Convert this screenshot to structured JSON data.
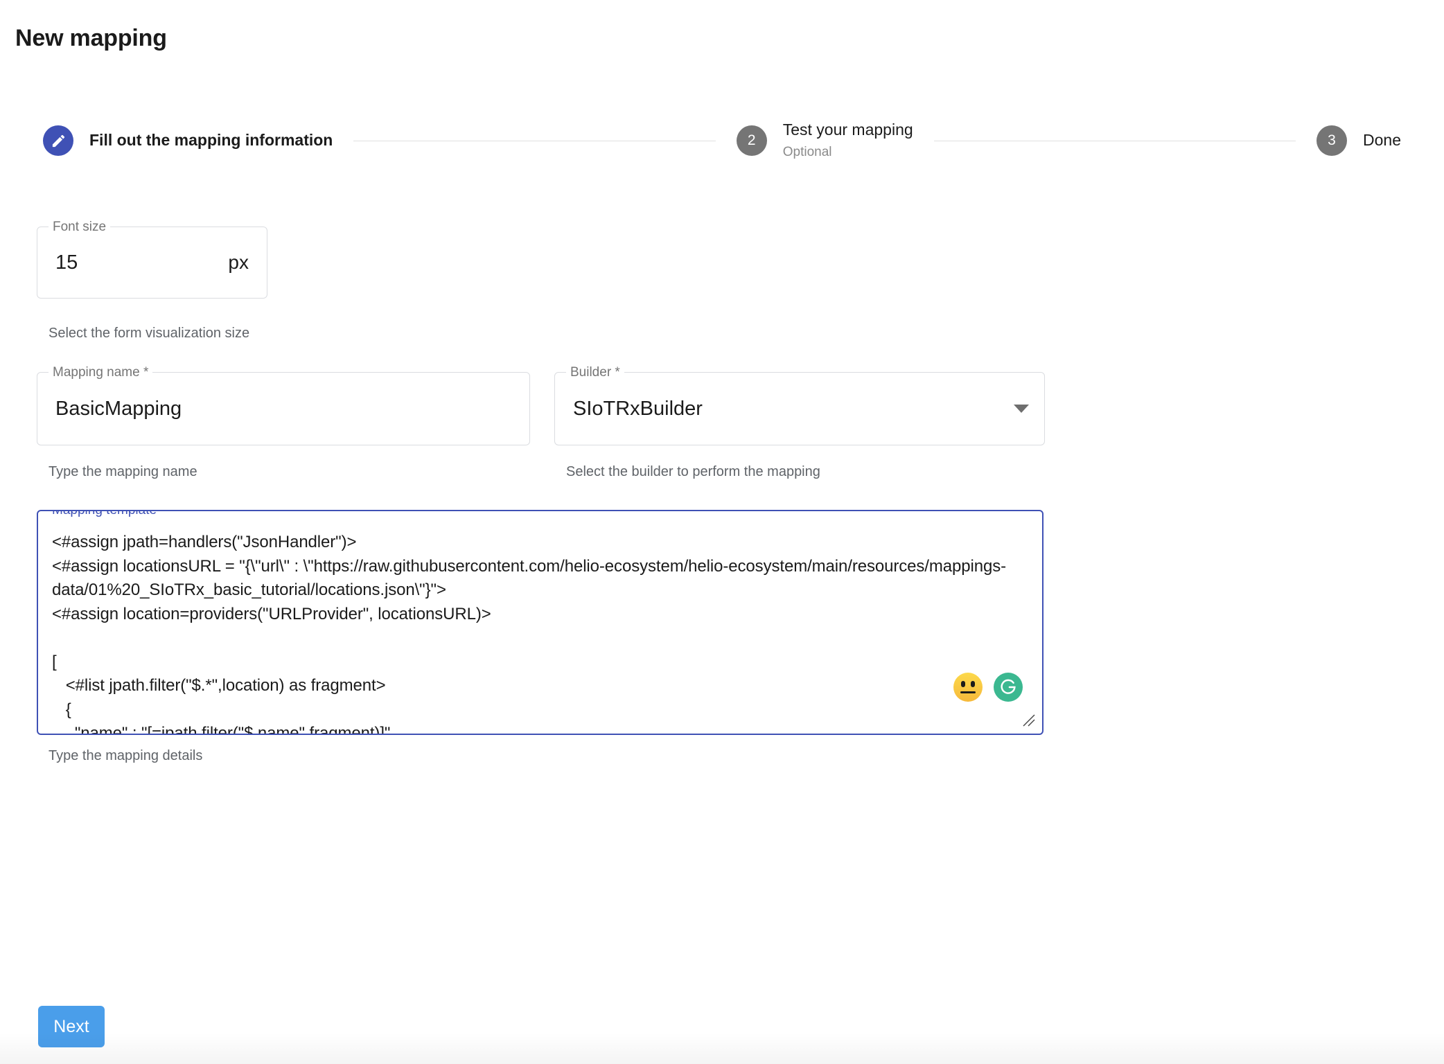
{
  "page": {
    "title": "New mapping"
  },
  "stepper": {
    "steps": [
      {
        "number": "",
        "icon": "pencil-icon",
        "label": "Fill out the mapping information",
        "sub": "",
        "state": "active"
      },
      {
        "number": "2",
        "icon": "",
        "label": "Test your mapping",
        "sub": "Optional",
        "state": "inactive"
      },
      {
        "number": "3",
        "icon": "",
        "label": "Done",
        "sub": "",
        "state": "inactive"
      }
    ]
  },
  "form": {
    "font_size": {
      "legend": "Font size",
      "value": "15",
      "suffix": "px",
      "helper": "Select the form visualization size"
    },
    "mapping_name": {
      "legend": "Mapping name *",
      "value": "BasicMapping",
      "helper": "Type the mapping name"
    },
    "builder": {
      "legend": "Builder *",
      "value": "SIoTRxBuilder",
      "helper": "Select the builder to perform the mapping",
      "arrow_icon": "chevron-down-icon"
    },
    "mapping_template": {
      "legend_text": "Mapping template ",
      "legend_required": "*",
      "value": "<#assign jpath=handlers(\"JsonHandler\")>\n<#assign locationsURL = \"{\\\"url\\\" : \\\"https://raw.githubusercontent.com/helio-ecosystem/helio-ecosystem/main/resources/mappings-data/01%20_SIoTRx_basic_tutorial/locations.json\\\"}\">\n<#assign location=providers(\"URLProvider\", locationsURL)>\n\n[\n   <#list jpath.filter(\"$.*\",location) as fragment>\n   {\n     \"name\" : \"[=jpath.filter(\"$.name\",fragment)]\"\n   }<#if fragment?is_last><#else>,</#if>\n   </#list>\n]",
      "helper": "Type the mapping details",
      "adornments": [
        {
          "name": "emoji-neutral-icon",
          "color": "#f6b93b"
        },
        {
          "name": "grammarly-icon",
          "color": "#3bb890"
        }
      ],
      "resize_handle": "resize-handle-icon"
    }
  },
  "actions": {
    "next_label": "Next"
  },
  "colors": {
    "accent_indigo": "#3f51b5",
    "step_inactive": "#757575",
    "required_asterisk": "#f44f7f",
    "primary_button": "#4a9eea",
    "field_border": "#dadce0"
  }
}
